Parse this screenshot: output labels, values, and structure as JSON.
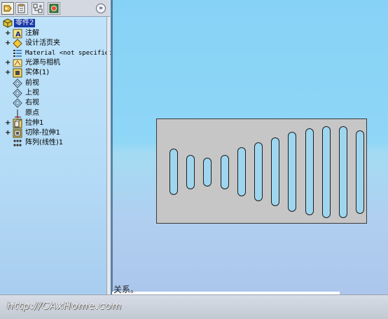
{
  "toolbar": {
    "buttons": [
      {
        "name": "feature-manager-tab",
        "icon": "feature-tree-icon"
      },
      {
        "name": "property-manager-tab",
        "icon": "property-icon"
      },
      {
        "name": "configuration-manager-tab",
        "icon": "configuration-icon"
      },
      {
        "name": "display-manager-tab",
        "icon": "display-icon"
      }
    ],
    "expand_label": "»"
  },
  "tree": {
    "root": "零件2",
    "items": [
      {
        "label": "注解",
        "icon": "annotation-icon",
        "expandable": true
      },
      {
        "label": "设计活页夹",
        "icon": "design-binder-icon",
        "expandable": true
      },
      {
        "label": "Material <not specified>",
        "icon": "material-icon",
        "expandable": false
      },
      {
        "label": "光源与相机",
        "icon": "lights-cameras-icon",
        "expandable": true
      },
      {
        "label": "实体(1)",
        "icon": "solid-bodies-icon",
        "expandable": true
      },
      {
        "label": "前视",
        "icon": "plane-icon",
        "expandable": false
      },
      {
        "label": "上视",
        "icon": "plane-icon",
        "expandable": false
      },
      {
        "label": "右视",
        "icon": "plane-icon",
        "expandable": false
      },
      {
        "label": "原点",
        "icon": "origin-icon",
        "expandable": false
      },
      {
        "label": "拉伸1",
        "icon": "extrude-icon",
        "expandable": true
      },
      {
        "label": "切除-拉伸1",
        "icon": "cut-extrude-icon",
        "expandable": true
      },
      {
        "label": "阵列(线性)1",
        "icon": "linear-pattern-icon",
        "expandable": false
      }
    ]
  },
  "graphics": {
    "slot_heights": [
      0.5,
      0.37,
      0.31,
      0.37,
      0.53,
      0.64,
      0.74,
      0.86,
      0.94,
      0.99,
      0.99,
      0.9
    ]
  },
  "footer": {
    "url": "http://CAxHome.com",
    "caption": "关系。"
  }
}
